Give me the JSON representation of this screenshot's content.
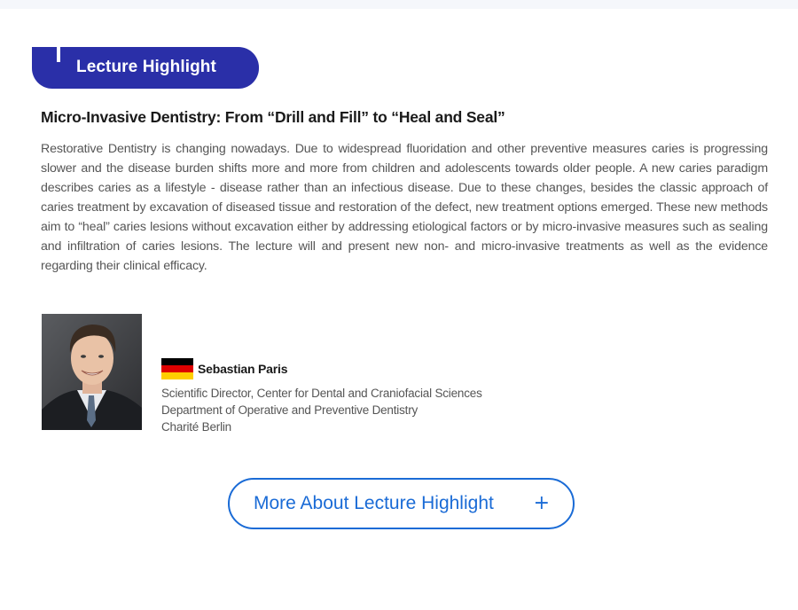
{
  "section": {
    "badge_label": "Lecture Highlight"
  },
  "lecture": {
    "title": "Micro-Invasive Dentistry: From “Drill and Fill” to “Heal and Seal”",
    "body": "Restorative Dentistry is changing nowadays. Due to widespread fluoridation and other preventive measures caries is progressing slower and the disease burden shifts more and more from children and adolescents towards older people. A new caries paradigm describes caries as a lifestyle - disease rather than an infectious disease. Due to these changes, besides the classic approach of caries treatment by excavation of diseased tissue and restoration of the defect, new treatment options emerged. These new methods aim to “heal” caries lesions without excavation either by addressing etiological factors or by micro-invasive measures such as sealing and infiltration of caries lesions. The lecture will and present new non- and micro-invasive treatments as well as the evidence regarding their clinical efficacy."
  },
  "speaker": {
    "name": "Sebastian Paris",
    "flag_icon": "germany-flag-icon",
    "flag_colors": [
      "#000000",
      "#dd0000",
      "#ffce00"
    ],
    "affiliation": [
      "Scientific Director, Center for Dental and Craniofacial Sciences",
      "Department of Operative and Preventive Dentistry",
      "Charité Berlin"
    ]
  },
  "cta": {
    "label": "More About Lecture Highlight",
    "icon": "plus-icon",
    "icon_glyph": "+"
  },
  "colors": {
    "badge_bg": "#2a2fa8",
    "accent": "#1a6bd6",
    "body_text": "#555555",
    "heading_text": "#1a1a1a"
  }
}
